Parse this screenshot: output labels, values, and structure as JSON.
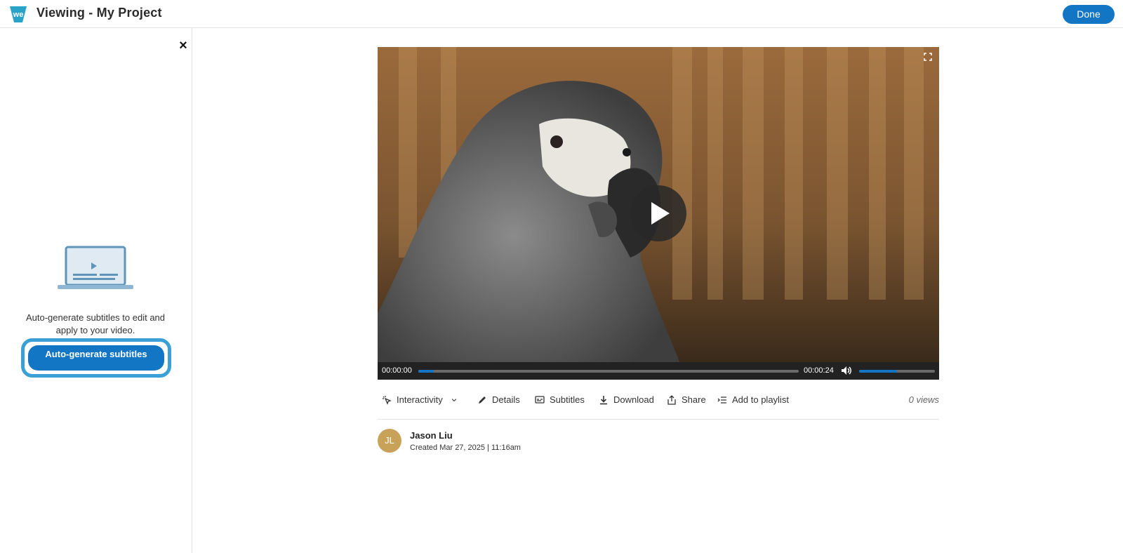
{
  "app": {
    "title": "Viewing - My Project",
    "logo_text": "we"
  },
  "header": {
    "done_label": "Done"
  },
  "sidebar": {
    "description": "Auto-generate subtitles to edit and apply to your video.",
    "auto_button_label": "Auto-generate subtitles",
    "close_icon": "close-icon",
    "illustration_icon": "laptop-video-icon"
  },
  "player": {
    "current_time": "00:00:00",
    "duration": "00:00:24",
    "progress_fraction": 0.04,
    "volume_fraction": 0.5
  },
  "actions": {
    "interactivity": "Interactivity",
    "details": "Details",
    "subtitles": "Subtitles",
    "download": "Download",
    "share": "Share",
    "add_to_playlist": "Add to playlist",
    "views": "0 views"
  },
  "author": {
    "initials": "JL",
    "name": "Jason Liu",
    "created": "Created Mar 27, 2025 | 11:16am"
  },
  "colors": {
    "accent": "#1276c5",
    "focus_ring": "#3aa0d6",
    "avatar": "#c9a25a"
  }
}
